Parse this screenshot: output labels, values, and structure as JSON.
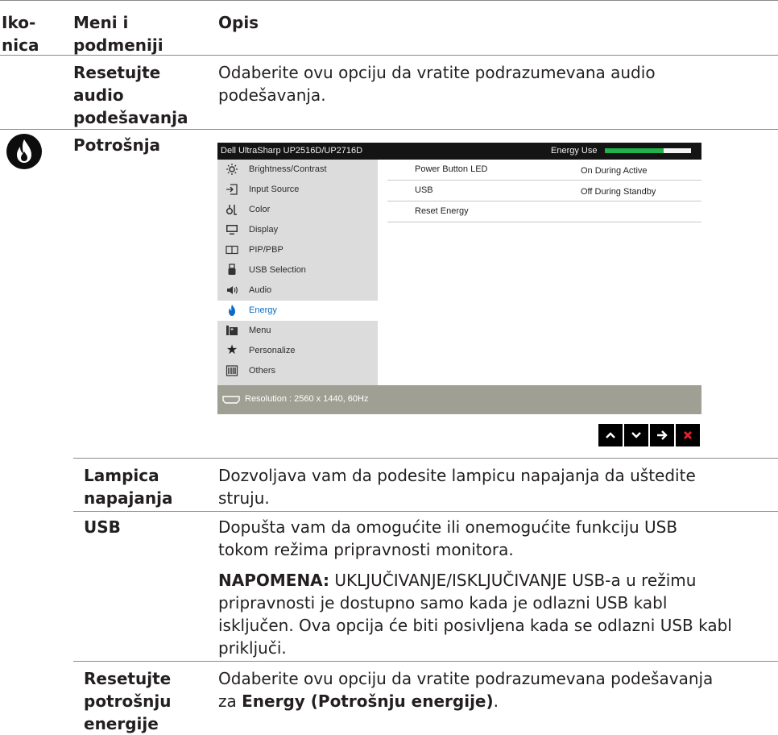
{
  "header": {
    "col_icon": "Iko-\nnica",
    "col_menu": "Meni i\npodmeniji",
    "col_desc": "Opis"
  },
  "row_reset_audio": {
    "menu": "Resetujte\naudio\npodešavanja",
    "desc": "Odaberite ovu opciju da vratite podrazumevana audio\npodešavanja."
  },
  "row_energy": {
    "menu": "Potrošnja",
    "icon": "energy-flame-icon"
  },
  "osd": {
    "title": "Dell UltraSharp UP2516D/UP2716D",
    "energy_use_label": "Energy Use",
    "energy_level": 0.68,
    "menu_items": [
      {
        "label": "Brightness/Contrast",
        "icon": "brightness-icon"
      },
      {
        "label": "Input Source",
        "icon": "input-source-icon"
      },
      {
        "label": "Color",
        "icon": "color-icon"
      },
      {
        "label": "Display",
        "icon": "display-icon"
      },
      {
        "label": "PIP/PBP",
        "icon": "pip-pbp-icon"
      },
      {
        "label": "USB Selection",
        "icon": "usb-icon"
      },
      {
        "label": "Audio",
        "icon": "audio-icon"
      },
      {
        "label": "Energy",
        "icon": "energy-icon"
      },
      {
        "label": "Menu",
        "icon": "menu-icon"
      },
      {
        "label": "Personalize",
        "icon": "star-icon"
      },
      {
        "label": "Others",
        "icon": "others-icon"
      }
    ],
    "submenu": [
      {
        "label": "Power Button LED",
        "value": "On During Active"
      },
      {
        "label": "USB",
        "value": "Off During Standby"
      },
      {
        "label": "Reset Energy",
        "value": ""
      }
    ],
    "status": "Resolution : 2560 x 1440, 60Hz",
    "colors": {
      "accent": "#0a6dc5",
      "energy_bar": "#21b24b",
      "close": "#e8212e"
    }
  },
  "nav_buttons": [
    "up-arrow-icon",
    "down-arrow-icon",
    "right-arrow-icon",
    "close-icon"
  ],
  "rows": {
    "lamp": {
      "menu": "Lampica\nnapajanja",
      "desc": "Dozvoljava vam da podesite lampicu napajanja da uštedite\nstruju."
    },
    "usb": {
      "menu": "USB",
      "desc": "Dopušta vam da omogućite ili onemogućite funkciju USB\ntokom režima pripravnosti monitora.",
      "note_label": "NAPOMENA:",
      "note_text": " UKLJUČIVANJE/ISKLJUČIVANJE USB-a u režimu\npripravnosti je dostupno samo kada je odlazni USB kabl\nisključen. Ova opcija će biti posivljena kada se odlazni USB kabl\npriključi."
    },
    "reset_energy": {
      "menu": "Resetujte\npotrošnju\nenergije",
      "desc_a": "Odaberite ovu opciju da vratite podrazumevana podešavanja\nza ",
      "desc_bold": "Energy (Potrošnju energije)",
      "desc_b": "."
    }
  }
}
